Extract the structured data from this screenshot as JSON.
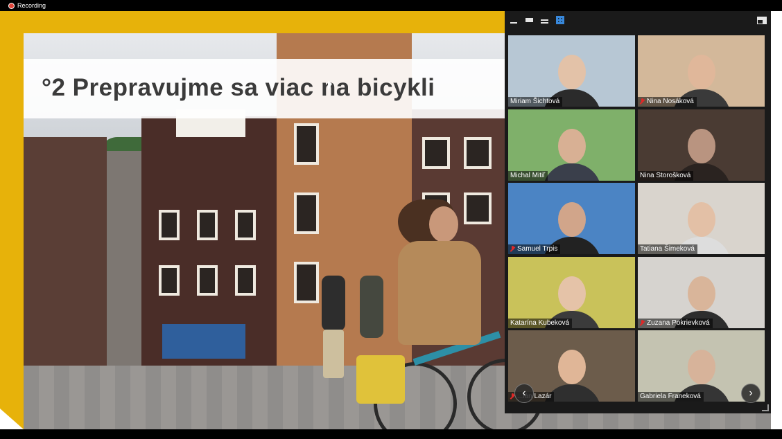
{
  "recording": {
    "label": "Recording"
  },
  "slide": {
    "title": "°2 Prepravujme sa viac na bicykli"
  },
  "gallery": {
    "toolbar": {
      "minimize": "minimize-icon",
      "speaker_view": "speaker-view-icon",
      "strip_view": "strip-view-icon",
      "gallery_view": "gallery-view-icon",
      "exit_fullscreen": "exit-fullscreen-icon"
    },
    "participants": [
      {
        "name": "Miriam Šichtová",
        "muted": false,
        "bg": "#b7c7d4",
        "skin": "#e3c2a8",
        "shirt": "#2b2b2b"
      },
      {
        "name": "Nina Nosáková",
        "muted": true,
        "bg": "#d3b89a",
        "skin": "#e0b79a",
        "shirt": "#3a3a3a"
      },
      {
        "name": "Michal Mitiľ",
        "muted": false,
        "bg": "#7fb06a",
        "skin": "#d8b094",
        "shirt": "#3a3f4b"
      },
      {
        "name": "Nina Storošková",
        "muted": false,
        "bg": "#4a3b33",
        "skin": "#b99480",
        "shirt": "#2a2320"
      },
      {
        "name": "Samuel Trpis",
        "muted": true,
        "bg": "#4b84c4",
        "skin": "#d1a58a",
        "shirt": "#222"
      },
      {
        "name": "Tatiana Šimeková",
        "muted": false,
        "bg": "#d9d4cd",
        "skin": "#e3c0a6",
        "shirt": "#ddd"
      },
      {
        "name": "Katarína Kubeková",
        "muted": false,
        "bg": "#c9c25a",
        "skin": "#e5c3a8",
        "shirt": "#3b3b3b"
      },
      {
        "name": "Zuzana Pokrievková",
        "muted": true,
        "bg": "#d6d3cf",
        "skin": "#d9b59a",
        "shirt": "#2d2d2d"
      },
      {
        "name": "...ián Lazár",
        "muted": true,
        "bg": "#6c5c4b",
        "skin": "#e0b697",
        "shirt": "#2f2f2f"
      },
      {
        "name": "Gabriela Franeková",
        "muted": false,
        "bg": "#c4c3b1",
        "skin": "#d7b39a",
        "shirt": "#353535"
      }
    ],
    "nav": {
      "prev": "‹",
      "next": "›"
    }
  }
}
